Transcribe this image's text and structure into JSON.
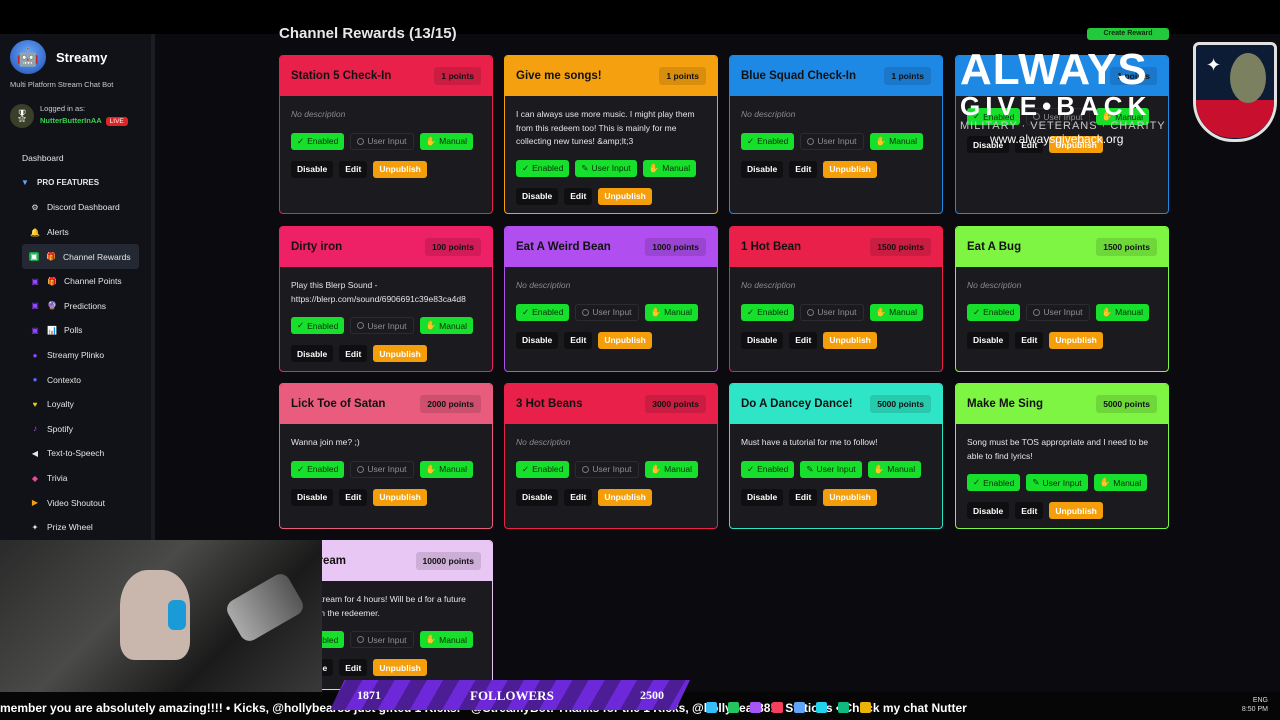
{
  "app": {
    "name": "Streamy",
    "tagline": "Multi Platform Stream Chat Bot",
    "logged_in_label": "Logged in as:",
    "username": "NutterButterInAA",
    "live_badge": "LIVE"
  },
  "nav": {
    "dashboard": "Dashboard",
    "pro_features": "PRO FEATURES",
    "items": [
      {
        "label": "Discord Dashboard",
        "icon": "discord-icon"
      },
      {
        "label": "Alerts",
        "icon": "bell-icon"
      },
      {
        "label": "Channel Rewards",
        "icon": "gift-icon"
      },
      {
        "label": "Channel Points",
        "icon": "gift-icon"
      },
      {
        "label": "Predictions",
        "icon": "crystal-ball-icon"
      },
      {
        "label": "Polls",
        "icon": "bar-chart-icon"
      },
      {
        "label": "Streamy Plinko",
        "icon": "plinko-icon"
      },
      {
        "label": "Contexto",
        "icon": "contexto-icon"
      },
      {
        "label": "Loyalty",
        "icon": "heart-icon"
      },
      {
        "label": "Spotify",
        "icon": "music-icon"
      },
      {
        "label": "Text-to-Speech",
        "icon": "speaker-icon"
      },
      {
        "label": "Trivia",
        "icon": "trivia-icon"
      },
      {
        "label": "Video Shoutout",
        "icon": "video-icon"
      },
      {
        "label": "Prize Wheel",
        "icon": "wheel-icon"
      }
    ]
  },
  "page": {
    "title": "Channel Rewards (13/15)",
    "create_button": "Create Reward"
  },
  "labels": {
    "enabled": "Enabled",
    "user_input": "User Input",
    "manual": "Manual",
    "disable": "Disable",
    "edit": "Edit",
    "unpublish": "Unpublish",
    "no_description": "No description"
  },
  "rewards": [
    {
      "title": "Station 5 Check-In",
      "points": "1 points",
      "desc": "No description",
      "color": "#e8204a"
    },
    {
      "title": "Give me songs!",
      "points": "1 points",
      "desc": "I can always use more music. I might play them from this redeem too! This is mainly for me collecting new tunes! &amp;lt;3",
      "color": "#f5a10f"
    },
    {
      "title": "Blue Squad Check-In",
      "points": "1 points",
      "desc": "No description",
      "color": "#1e88e5"
    },
    {
      "title": "",
      "points": "1 points",
      "desc": "",
      "color": "#1e88e5"
    },
    {
      "title": "Dirty iron",
      "points": "100 points",
      "desc": "Play this Blerp Sound - https://blerp.com/sound/6906691c39e83ca4d8",
      "color": "#ee2066"
    },
    {
      "title": "Eat A Weird Bean",
      "points": "1000 points",
      "desc": "No description",
      "color": "#b04ef0"
    },
    {
      "title": "1 Hot Bean",
      "points": "1500 points",
      "desc": "No description",
      "color": "#e8204a"
    },
    {
      "title": "Eat A Bug",
      "points": "1500 points",
      "desc": "No description",
      "color": "#7ef542"
    },
    {
      "title": "Lick Toe of Satan",
      "points": "2000 points",
      "desc": "Wanna join me? ;)",
      "color": "#ea5c7e"
    },
    {
      "title": "3 Hot Beans",
      "points": "3000 points",
      "desc": "No description",
      "color": "#e8204a"
    },
    {
      "title": "Do A Dancey Dance!",
      "points": "5000 points",
      "desc": "Must have a tutorial for me to follow!",
      "color": "#2ee6c7"
    },
    {
      "title": "Make Me Sing",
      "points": "5000 points",
      "desc": "Song must be TOS appropriate and I need to be able to find lyrics!",
      "color": "#7ef542"
    },
    {
      "title": "ke Stream",
      "points": "10000 points",
      "desc": "raoke Stream for 4 hours! Will be d for a future date with the redeemer.",
      "color": "#e9c7f5"
    }
  ],
  "overlay": {
    "always": "ALWAYS",
    "give_back": "GIVE•BACK",
    "mission": "MILITARY · VETERANS · CHARITY",
    "url": "www.alwaysgiveback.org"
  },
  "stream": {
    "followers_label": "FOLLOWERS",
    "followers_current": "1871",
    "followers_goal": "2500",
    "ticker": "member you are absolutely amazing!!!! • Kicks, @hollybear88 just gifted 1 Kicks. • @StreamyBot: Thanks for the 1 Kicks, @hollybear88! • Stations • Check my chat Nutter",
    "lang": "ENG",
    "time": "8:50 PM"
  }
}
